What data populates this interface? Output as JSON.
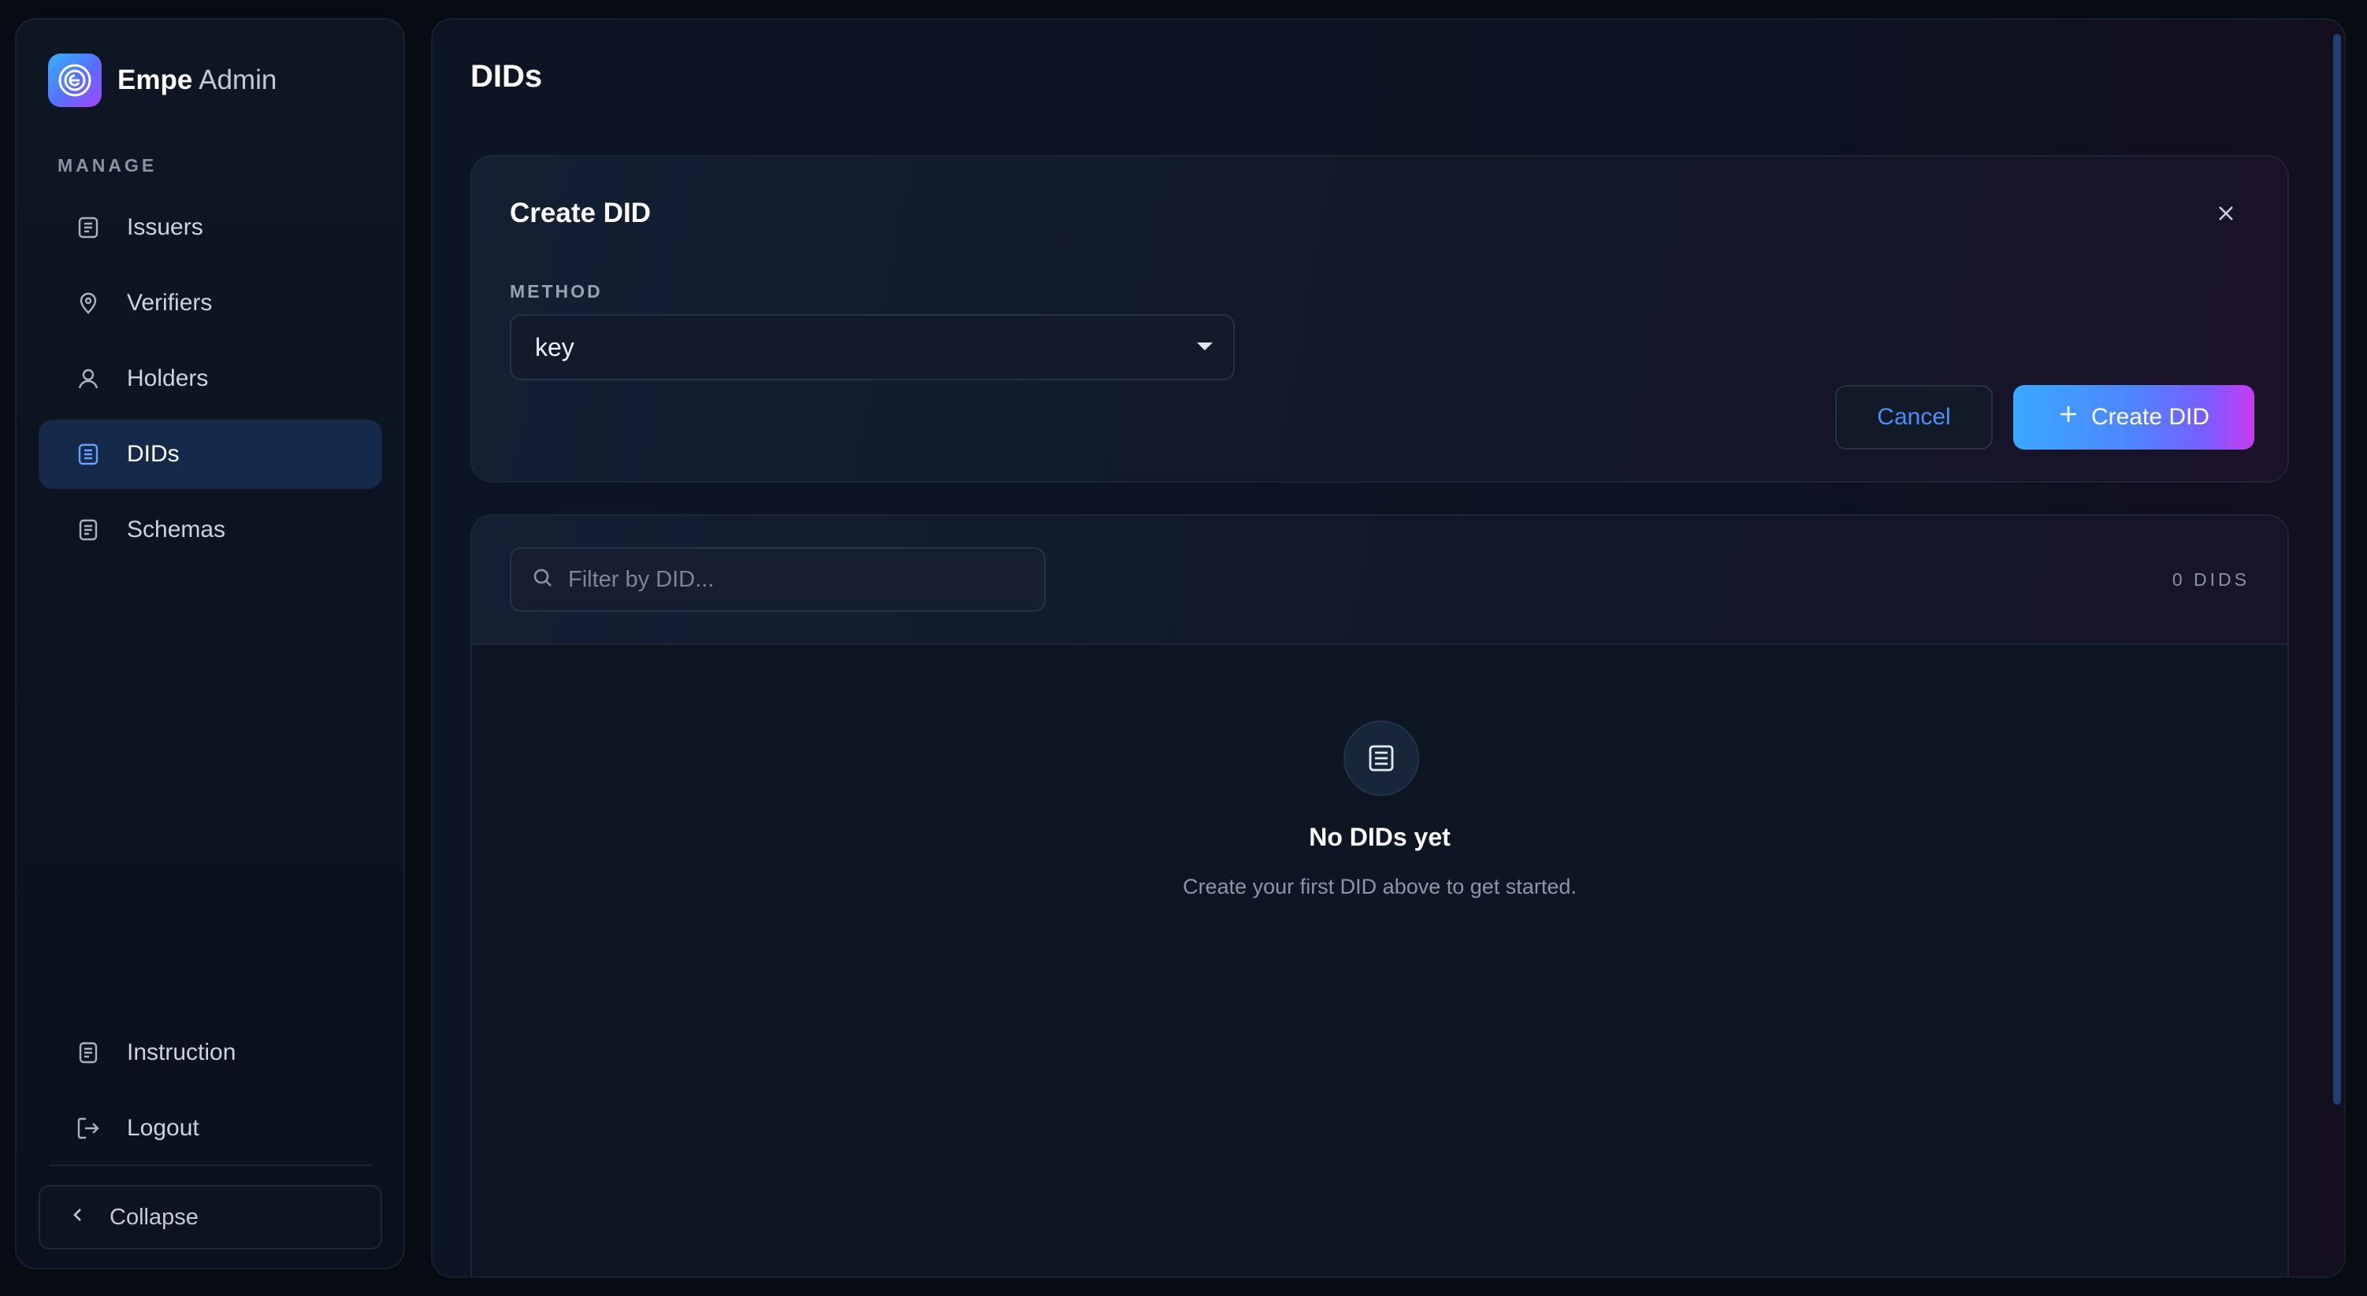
{
  "brand": {
    "name_bold": "Empe",
    "name_light": "Admin"
  },
  "sidebar": {
    "section_label": "MANAGE",
    "items": [
      {
        "label": "Issuers",
        "icon": "document-icon"
      },
      {
        "label": "Verifiers",
        "icon": "location-pin-icon"
      },
      {
        "label": "Holders",
        "icon": "user-icon"
      },
      {
        "label": "DIDs",
        "icon": "document-icon",
        "active": true
      },
      {
        "label": "Schemas",
        "icon": "document-icon"
      }
    ],
    "bottom_items": [
      {
        "label": "Instruction",
        "icon": "document-icon"
      },
      {
        "label": "Logout",
        "icon": "logout-icon"
      }
    ],
    "collapse_label": "Collapse"
  },
  "page": {
    "title": "DIDs"
  },
  "create_card": {
    "title": "Create DID",
    "method_label": "METHOD",
    "method_value": "key",
    "cancel_label": "Cancel",
    "create_label": "Create DID"
  },
  "list": {
    "filter_placeholder": "Filter by DID...",
    "count_label": "0 DIDS",
    "empty_title": "No DIDs yet",
    "empty_subtitle": "Create your first DID above to get started."
  },
  "colors": {
    "accent": "#4d8dff",
    "active_nav_bg": "#15294a",
    "gradient_start": "#3aa8ff",
    "gradient_end": "#c63bf0"
  }
}
